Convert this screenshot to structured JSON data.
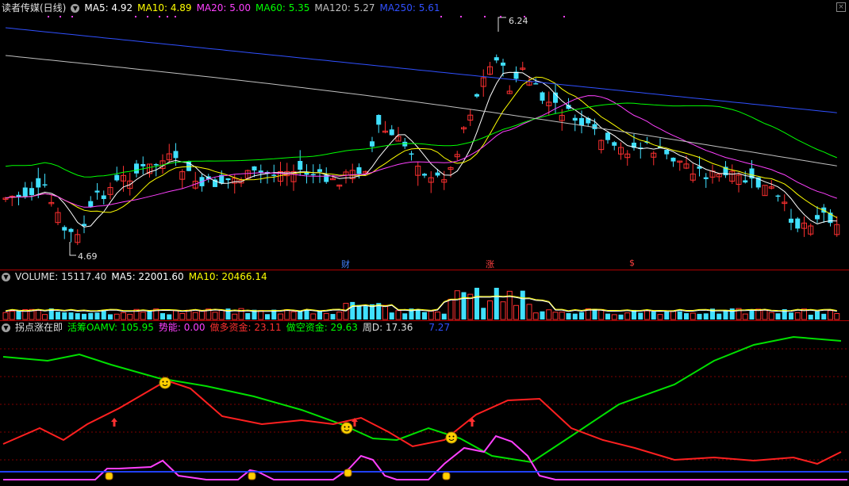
{
  "price_header": {
    "title": "读者传媒(日线)",
    "ma5": "MA5: 4.92",
    "ma10": "MA10: 4.89",
    "ma20": "MA20: 5.00",
    "ma60": "MA60: 5.35",
    "ma120": "MA120: 5.27",
    "ma250": "MA250: 5.61"
  },
  "price_labels": {
    "high": "6.24",
    "low": "4.69"
  },
  "event_markers": {
    "m1": "财",
    "m2": "涨",
    "m3": "$"
  },
  "volume_header": {
    "volume": "VOLUME: 15117.40",
    "ma5": "MA5: 22001.60",
    "ma10": "MA10: 20466.14"
  },
  "indicator_header": {
    "name": "拐点涨在即",
    "oamv": "活筹OAMV: 105.95",
    "shineng": "势能: 0.00",
    "zuoduo": "做多资金: 23.11",
    "zuokong": "做空资金: 29.63",
    "zhoud": "周D: 17.36",
    "extra": "7.27"
  },
  "colors": {
    "ma5": "#ffffff",
    "ma10": "#ffff00",
    "ma20": "#ff40ff",
    "ma60": "#00ff00",
    "ma120": "#c0c0c0",
    "ma250": "#3050ff",
    "up": "#ff3030",
    "down": "#40e0ff",
    "grid": "#800000"
  },
  "chart_data": {
    "type": "candlestick",
    "y_range": [
      4.6,
      6.3
    ],
    "highest": 6.24,
    "lowest": 4.69
  }
}
